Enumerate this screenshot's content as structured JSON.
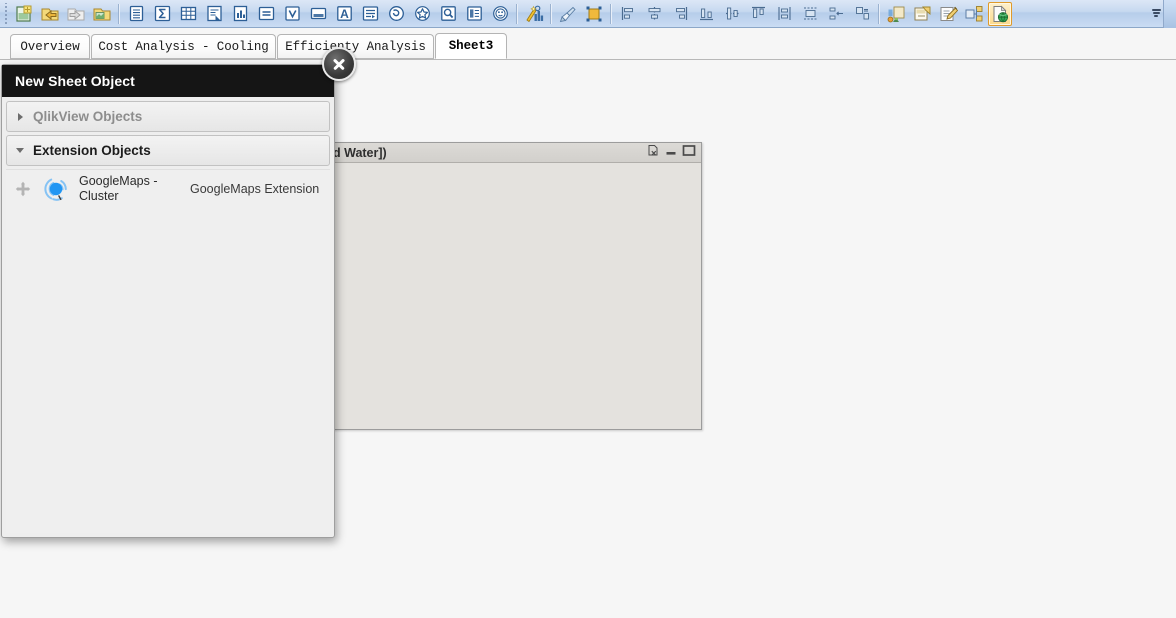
{
  "toolbar": {
    "grip_name": "toolbar-grip",
    "groups": [
      {
        "name": "file-group",
        "buttons": [
          {
            "name": "new-document-button",
            "icon": "new-document-icon",
            "active": false
          },
          {
            "name": "open-document-button",
            "icon": "open-folder-back-icon",
            "active": false
          },
          {
            "name": "forward-button",
            "icon": "open-folder-forward-icon",
            "active": false
          },
          {
            "name": "open-recent-button",
            "icon": "open-folder-icon",
            "active": false
          }
        ]
      },
      {
        "name": "object-group",
        "buttons": [
          {
            "name": "list-box-button",
            "icon": "list-box-icon",
            "active": false
          },
          {
            "name": "statistics-box-button",
            "icon": "sigma-icon",
            "active": false
          },
          {
            "name": "multi-box-button",
            "icon": "grid-table-icon",
            "active": false
          },
          {
            "name": "table-box-button",
            "icon": "table-box-icon",
            "active": false
          },
          {
            "name": "chart-button",
            "icon": "bar-chart-icon",
            "active": false
          },
          {
            "name": "input-box-button",
            "icon": "input-box-icon",
            "active": false
          },
          {
            "name": "current-selections-button",
            "icon": "checkmark-box-icon",
            "active": false
          },
          {
            "name": "multi-box-2-button",
            "icon": "window-box-icon",
            "active": false
          },
          {
            "name": "text-object-button",
            "icon": "text-a-icon",
            "active": false
          },
          {
            "name": "line-arrow-button",
            "icon": "line-arrow-icon",
            "active": false
          },
          {
            "name": "slider-calendar-button",
            "icon": "slider-circle-icon",
            "active": false
          },
          {
            "name": "bookmark-button",
            "icon": "star-icon",
            "active": false
          },
          {
            "name": "search-object-button",
            "icon": "magnifier-icon",
            "active": false
          },
          {
            "name": "container-button",
            "icon": "container-icon",
            "active": false
          },
          {
            "name": "custom-object-button",
            "icon": "smiley-icon",
            "active": false
          }
        ]
      },
      {
        "name": "tools-group",
        "buttons": [
          {
            "name": "quick-chart-wizard-button",
            "icon": "wizard-wand-chart-icon",
            "active": false
          }
        ]
      },
      {
        "name": "format-group",
        "buttons": [
          {
            "name": "format-painter-button",
            "icon": "paintbrush-icon",
            "active": false
          },
          {
            "name": "object-properties-button",
            "icon": "selected-object-icon",
            "active": false
          }
        ]
      },
      {
        "name": "align-group",
        "buttons": [
          {
            "name": "align-left-button",
            "icon": "align-left-icon",
            "active": false
          },
          {
            "name": "align-center-horizontal-button",
            "icon": "align-center-h-icon",
            "active": false
          },
          {
            "name": "align-right-button",
            "icon": "align-right-icon",
            "active": false
          },
          {
            "name": "align-bottom-button",
            "icon": "align-bottom-icon",
            "active": false
          },
          {
            "name": "align-middle-button",
            "icon": "align-middle-icon",
            "active": false
          },
          {
            "name": "align-top-button",
            "icon": "align-top-icon",
            "active": false
          },
          {
            "name": "distribute-vertical-button",
            "icon": "distribute-vertical-icon",
            "active": false
          },
          {
            "name": "space-horizontally-button",
            "icon": "space-horizontal-icon",
            "active": false
          },
          {
            "name": "space-equally-button",
            "icon": "space-equal-icon",
            "active": false
          },
          {
            "name": "resize-same-button",
            "icon": "resize-same-icon",
            "active": false
          }
        ]
      },
      {
        "name": "sheet-group",
        "buttons": [
          {
            "name": "promote-sheet-button",
            "icon": "promote-sheet-icon",
            "active": false
          },
          {
            "name": "new-sheet-button",
            "icon": "new-sheet-icon",
            "active": false
          },
          {
            "name": "edit-sheet-button",
            "icon": "edit-sheet-icon",
            "active": false
          },
          {
            "name": "sheet-properties-button",
            "icon": "sheet-link-icon",
            "active": false
          },
          {
            "name": "new-sheet-object-button",
            "icon": "page-globe-icon",
            "active": true
          }
        ]
      }
    ],
    "overflow_name": "toolbar-overflow-button"
  },
  "tabs": [
    {
      "label": "Overview",
      "active": false
    },
    {
      "label": "Cost Analysis - Cooling",
      "active": false
    },
    {
      "label": "Efficienty Analysis",
      "active": false
    },
    {
      "label": "Sheet3",
      "active": true
    }
  ],
  "sheet_object": {
    "caption": "d Water])",
    "controls": [
      {
        "name": "clear-selections-icon"
      },
      {
        "name": "minimize-icon"
      },
      {
        "name": "maximize-icon"
      }
    ]
  },
  "dialog": {
    "title": "New Sheet Object",
    "close_label": "close",
    "sections": [
      {
        "label": "QlikView Objects",
        "expanded": false
      },
      {
        "label": "Extension Objects",
        "expanded": true
      }
    ],
    "extensions": [
      {
        "name": "GoogleMaps - Cluster",
        "type": "GoogleMaps Extension",
        "icon": "googlemaps-cluster-icon"
      }
    ]
  },
  "colors": {
    "toolbar_top": "#dce7f6",
    "toolbar_bottom": "#cadcf3",
    "dialog_header_bg": "#151515",
    "accent_active_border": "#e09a2a",
    "cluster_blue": "#2196f3",
    "canvas_bg": "#f6f6f6",
    "sheet_object_bg": "#e4e2de"
  }
}
